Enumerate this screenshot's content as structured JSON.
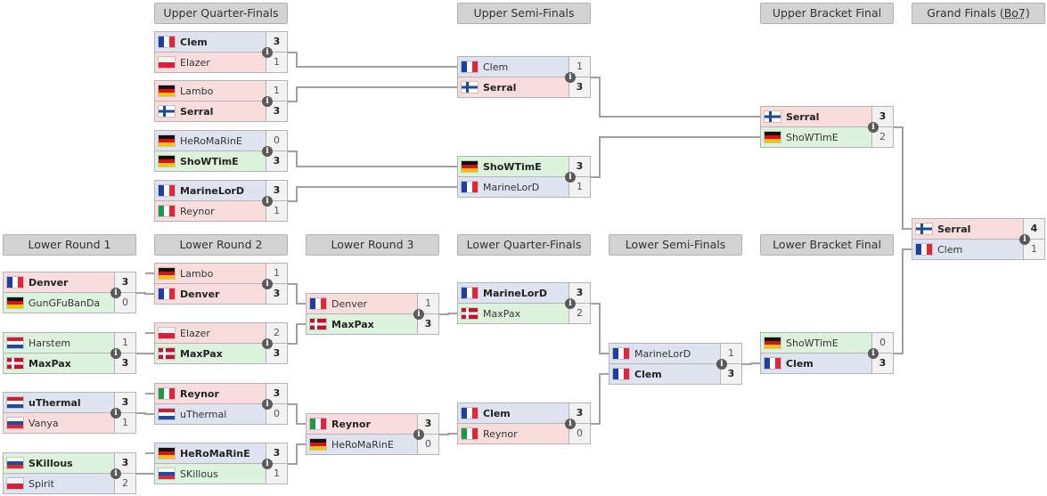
{
  "colors": {
    "terran": "#dfe3ef",
    "zerg": "#f9dddd",
    "protoss": "#dcf2dc",
    "line": "#a0a0a0",
    "header": "#d2d2d2"
  },
  "headers": [
    {
      "id": "uqf",
      "label": "Upper Quarter-Finals"
    },
    {
      "id": "usf",
      "label": "Upper Semi-Finals"
    },
    {
      "id": "ubf",
      "label": "Upper Bracket Final"
    },
    {
      "id": "gf",
      "label": "Grand Finals (",
      "abbr": "Bo7",
      "suffix": ")"
    },
    {
      "id": "lr1",
      "label": "Lower Round 1"
    },
    {
      "id": "lr2",
      "label": "Lower Round 2"
    },
    {
      "id": "lr3",
      "label": "Lower Round 3"
    },
    {
      "id": "lqf",
      "label": "Lower Quarter-Finals"
    },
    {
      "id": "lsf",
      "label": "Lower Semi-Finals"
    },
    {
      "id": "lbf",
      "label": "Lower Bracket Final"
    }
  ],
  "matches": [
    {
      "id": "uqf1",
      "players": [
        {
          "name": "Clem",
          "flag": "fr",
          "race": "terran",
          "score": "3",
          "win": true
        },
        {
          "name": "Elazer",
          "flag": "pl",
          "race": "zerg",
          "score": "1"
        }
      ]
    },
    {
      "id": "uqf2",
      "players": [
        {
          "name": "Lambo",
          "flag": "de",
          "race": "zerg",
          "score": "1"
        },
        {
          "name": "Serral",
          "flag": "fi",
          "race": "zerg",
          "score": "3",
          "win": true
        }
      ]
    },
    {
      "id": "uqf3",
      "players": [
        {
          "name": "HeRoMaRinE",
          "flag": "de",
          "race": "terran",
          "score": "0"
        },
        {
          "name": "ShoWTimE",
          "flag": "de",
          "race": "protoss",
          "score": "3",
          "win": true
        }
      ]
    },
    {
      "id": "uqf4",
      "players": [
        {
          "name": "MarineLorD",
          "flag": "fr",
          "race": "terran",
          "score": "3",
          "win": true
        },
        {
          "name": "Reynor",
          "flag": "it",
          "race": "zerg",
          "score": "1"
        }
      ]
    },
    {
      "id": "usf1",
      "players": [
        {
          "name": "Clem",
          "flag": "fr",
          "race": "terran",
          "score": "1"
        },
        {
          "name": "Serral",
          "flag": "fi",
          "race": "zerg",
          "score": "3",
          "win": true
        }
      ]
    },
    {
      "id": "usf2",
      "players": [
        {
          "name": "ShoWTimE",
          "flag": "de",
          "race": "protoss",
          "score": "3",
          "win": true
        },
        {
          "name": "MarineLorD",
          "flag": "fr",
          "race": "terran",
          "score": "1"
        }
      ]
    },
    {
      "id": "ubf",
      "players": [
        {
          "name": "Serral",
          "flag": "fi",
          "race": "zerg",
          "score": "3",
          "win": true
        },
        {
          "name": "ShoWTimE",
          "flag": "de",
          "race": "protoss",
          "score": "2"
        }
      ]
    },
    {
      "id": "gf",
      "players": [
        {
          "name": "Serral",
          "flag": "fi",
          "race": "zerg",
          "score": "4",
          "win": true
        },
        {
          "name": "Clem",
          "flag": "fr",
          "race": "terran",
          "score": "1"
        }
      ]
    },
    {
      "id": "lr1_1",
      "players": [
        {
          "name": "Denver",
          "flag": "fr",
          "race": "zerg",
          "score": "3",
          "win": true
        },
        {
          "name": "GunGFuBanDa",
          "flag": "de",
          "race": "protoss",
          "score": "0"
        }
      ]
    },
    {
      "id": "lr1_2",
      "players": [
        {
          "name": "Harstem",
          "flag": "nl",
          "race": "protoss",
          "score": "1"
        },
        {
          "name": "MaxPax",
          "flag": "dk",
          "race": "protoss",
          "score": "3",
          "win": true
        }
      ]
    },
    {
      "id": "lr1_3",
      "players": [
        {
          "name": "uThermal",
          "flag": "nl",
          "race": "terran",
          "score": "3",
          "win": true
        },
        {
          "name": "Vanya",
          "flag": "ru",
          "race": "zerg",
          "score": "1"
        }
      ]
    },
    {
      "id": "lr1_4",
      "players": [
        {
          "name": "SKillous",
          "flag": "ru",
          "race": "protoss",
          "score": "3",
          "win": true
        },
        {
          "name": "Spirit",
          "flag": "pl",
          "race": "terran",
          "score": "2"
        }
      ]
    },
    {
      "id": "lr2_1",
      "players": [
        {
          "name": "Lambo",
          "flag": "de",
          "race": "zerg",
          "score": "1"
        },
        {
          "name": "Denver",
          "flag": "fr",
          "race": "zerg",
          "score": "3",
          "win": true
        }
      ]
    },
    {
      "id": "lr2_2",
      "players": [
        {
          "name": "Elazer",
          "flag": "pl",
          "race": "zerg",
          "score": "2"
        },
        {
          "name": "MaxPax",
          "flag": "dk",
          "race": "protoss",
          "score": "3",
          "win": true
        }
      ]
    },
    {
      "id": "lr2_3",
      "players": [
        {
          "name": "Reynor",
          "flag": "it",
          "race": "zerg",
          "score": "3",
          "win": true
        },
        {
          "name": "uThermal",
          "flag": "nl",
          "race": "terran",
          "score": "0"
        }
      ]
    },
    {
      "id": "lr2_4",
      "players": [
        {
          "name": "HeRoMaRinE",
          "flag": "de",
          "race": "terran",
          "score": "3",
          "win": true
        },
        {
          "name": "SKillous",
          "flag": "ru",
          "race": "protoss",
          "score": "1"
        }
      ]
    },
    {
      "id": "lr3_1",
      "players": [
        {
          "name": "Denver",
          "flag": "fr",
          "race": "zerg",
          "score": "1"
        },
        {
          "name": "MaxPax",
          "flag": "dk",
          "race": "protoss",
          "score": "3",
          "win": true
        }
      ]
    },
    {
      "id": "lr3_2",
      "players": [
        {
          "name": "Reynor",
          "flag": "it",
          "race": "zerg",
          "score": "3",
          "win": true
        },
        {
          "name": "HeRoMaRinE",
          "flag": "de",
          "race": "terran",
          "score": "0"
        }
      ]
    },
    {
      "id": "lqf1",
      "players": [
        {
          "name": "MarineLorD",
          "flag": "fr",
          "race": "terran",
          "score": "3",
          "win": true
        },
        {
          "name": "MaxPax",
          "flag": "dk",
          "race": "protoss",
          "score": "2"
        }
      ]
    },
    {
      "id": "lqf2",
      "players": [
        {
          "name": "Clem",
          "flag": "fr",
          "race": "terran",
          "score": "3",
          "win": true
        },
        {
          "name": "Reynor",
          "flag": "it",
          "race": "zerg",
          "score": "0"
        }
      ]
    },
    {
      "id": "lsf",
      "players": [
        {
          "name": "MarineLorD",
          "flag": "fr",
          "race": "terran",
          "score": "1"
        },
        {
          "name": "Clem",
          "flag": "fr",
          "race": "terran",
          "score": "3",
          "win": true
        }
      ]
    },
    {
      "id": "lbf",
      "players": [
        {
          "name": "ShoWTimE",
          "flag": "de",
          "race": "protoss",
          "score": "0"
        },
        {
          "name": "Clem",
          "flag": "fr",
          "race": "terran",
          "score": "3",
          "win": true
        }
      ]
    }
  ]
}
